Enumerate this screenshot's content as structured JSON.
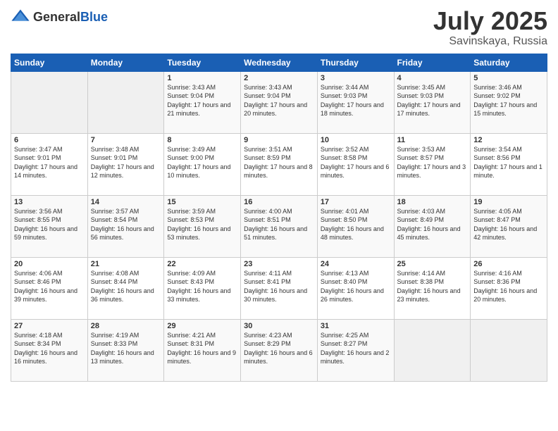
{
  "header": {
    "logo_general": "General",
    "logo_blue": "Blue",
    "month": "July 2025",
    "location": "Savinskaya, Russia"
  },
  "days_of_week": [
    "Sunday",
    "Monday",
    "Tuesday",
    "Wednesday",
    "Thursday",
    "Friday",
    "Saturday"
  ],
  "weeks": [
    [
      {
        "day": "",
        "empty": true
      },
      {
        "day": "",
        "empty": true
      },
      {
        "day": "1",
        "sunrise": "Sunrise: 3:43 AM",
        "sunset": "Sunset: 9:04 PM",
        "daylight": "Daylight: 17 hours and 21 minutes."
      },
      {
        "day": "2",
        "sunrise": "Sunrise: 3:43 AM",
        "sunset": "Sunset: 9:04 PM",
        "daylight": "Daylight: 17 hours and 20 minutes."
      },
      {
        "day": "3",
        "sunrise": "Sunrise: 3:44 AM",
        "sunset": "Sunset: 9:03 PM",
        "daylight": "Daylight: 17 hours and 18 minutes."
      },
      {
        "day": "4",
        "sunrise": "Sunrise: 3:45 AM",
        "sunset": "Sunset: 9:03 PM",
        "daylight": "Daylight: 17 hours and 17 minutes."
      },
      {
        "day": "5",
        "sunrise": "Sunrise: 3:46 AM",
        "sunset": "Sunset: 9:02 PM",
        "daylight": "Daylight: 17 hours and 15 minutes."
      }
    ],
    [
      {
        "day": "6",
        "sunrise": "Sunrise: 3:47 AM",
        "sunset": "Sunset: 9:01 PM",
        "daylight": "Daylight: 17 hours and 14 minutes."
      },
      {
        "day": "7",
        "sunrise": "Sunrise: 3:48 AM",
        "sunset": "Sunset: 9:01 PM",
        "daylight": "Daylight: 17 hours and 12 minutes."
      },
      {
        "day": "8",
        "sunrise": "Sunrise: 3:49 AM",
        "sunset": "Sunset: 9:00 PM",
        "daylight": "Daylight: 17 hours and 10 minutes."
      },
      {
        "day": "9",
        "sunrise": "Sunrise: 3:51 AM",
        "sunset": "Sunset: 8:59 PM",
        "daylight": "Daylight: 17 hours and 8 minutes."
      },
      {
        "day": "10",
        "sunrise": "Sunrise: 3:52 AM",
        "sunset": "Sunset: 8:58 PM",
        "daylight": "Daylight: 17 hours and 6 minutes."
      },
      {
        "day": "11",
        "sunrise": "Sunrise: 3:53 AM",
        "sunset": "Sunset: 8:57 PM",
        "daylight": "Daylight: 17 hours and 3 minutes."
      },
      {
        "day": "12",
        "sunrise": "Sunrise: 3:54 AM",
        "sunset": "Sunset: 8:56 PM",
        "daylight": "Daylight: 17 hours and 1 minute."
      }
    ],
    [
      {
        "day": "13",
        "sunrise": "Sunrise: 3:56 AM",
        "sunset": "Sunset: 8:55 PM",
        "daylight": "Daylight: 16 hours and 59 minutes."
      },
      {
        "day": "14",
        "sunrise": "Sunrise: 3:57 AM",
        "sunset": "Sunset: 8:54 PM",
        "daylight": "Daylight: 16 hours and 56 minutes."
      },
      {
        "day": "15",
        "sunrise": "Sunrise: 3:59 AM",
        "sunset": "Sunset: 8:53 PM",
        "daylight": "Daylight: 16 hours and 53 minutes."
      },
      {
        "day": "16",
        "sunrise": "Sunrise: 4:00 AM",
        "sunset": "Sunset: 8:51 PM",
        "daylight": "Daylight: 16 hours and 51 minutes."
      },
      {
        "day": "17",
        "sunrise": "Sunrise: 4:01 AM",
        "sunset": "Sunset: 8:50 PM",
        "daylight": "Daylight: 16 hours and 48 minutes."
      },
      {
        "day": "18",
        "sunrise": "Sunrise: 4:03 AM",
        "sunset": "Sunset: 8:49 PM",
        "daylight": "Daylight: 16 hours and 45 minutes."
      },
      {
        "day": "19",
        "sunrise": "Sunrise: 4:05 AM",
        "sunset": "Sunset: 8:47 PM",
        "daylight": "Daylight: 16 hours and 42 minutes."
      }
    ],
    [
      {
        "day": "20",
        "sunrise": "Sunrise: 4:06 AM",
        "sunset": "Sunset: 8:46 PM",
        "daylight": "Daylight: 16 hours and 39 minutes."
      },
      {
        "day": "21",
        "sunrise": "Sunrise: 4:08 AM",
        "sunset": "Sunset: 8:44 PM",
        "daylight": "Daylight: 16 hours and 36 minutes."
      },
      {
        "day": "22",
        "sunrise": "Sunrise: 4:09 AM",
        "sunset": "Sunset: 8:43 PM",
        "daylight": "Daylight: 16 hours and 33 minutes."
      },
      {
        "day": "23",
        "sunrise": "Sunrise: 4:11 AM",
        "sunset": "Sunset: 8:41 PM",
        "daylight": "Daylight: 16 hours and 30 minutes."
      },
      {
        "day": "24",
        "sunrise": "Sunrise: 4:13 AM",
        "sunset": "Sunset: 8:40 PM",
        "daylight": "Daylight: 16 hours and 26 minutes."
      },
      {
        "day": "25",
        "sunrise": "Sunrise: 4:14 AM",
        "sunset": "Sunset: 8:38 PM",
        "daylight": "Daylight: 16 hours and 23 minutes."
      },
      {
        "day": "26",
        "sunrise": "Sunrise: 4:16 AM",
        "sunset": "Sunset: 8:36 PM",
        "daylight": "Daylight: 16 hours and 20 minutes."
      }
    ],
    [
      {
        "day": "27",
        "sunrise": "Sunrise: 4:18 AM",
        "sunset": "Sunset: 8:34 PM",
        "daylight": "Daylight: 16 hours and 16 minutes."
      },
      {
        "day": "28",
        "sunrise": "Sunrise: 4:19 AM",
        "sunset": "Sunset: 8:33 PM",
        "daylight": "Daylight: 16 hours and 13 minutes."
      },
      {
        "day": "29",
        "sunrise": "Sunrise: 4:21 AM",
        "sunset": "Sunset: 8:31 PM",
        "daylight": "Daylight: 16 hours and 9 minutes."
      },
      {
        "day": "30",
        "sunrise": "Sunrise: 4:23 AM",
        "sunset": "Sunset: 8:29 PM",
        "daylight": "Daylight: 16 hours and 6 minutes."
      },
      {
        "day": "31",
        "sunrise": "Sunrise: 4:25 AM",
        "sunset": "Sunset: 8:27 PM",
        "daylight": "Daylight: 16 hours and 2 minutes."
      },
      {
        "day": "",
        "empty": true
      },
      {
        "day": "",
        "empty": true
      }
    ]
  ]
}
